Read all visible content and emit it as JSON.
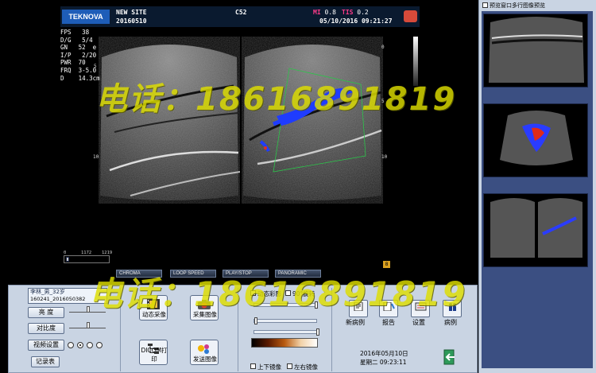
{
  "header": {
    "logo": "TEKNOVA",
    "site": "NEW SITE",
    "date": "20160510",
    "probe": "C52",
    "mi_label": "MI",
    "mi_value": "0.8",
    "tis_label": "TIS",
    "tis_value": "0.2",
    "datetime": "05/10/2016 09:21:27"
  },
  "params": [
    "FPS   38",
    "D/G   5/4",
    "GN   52  e",
    "I/P   2/20",
    "PWR  70",
    "FRQ  3-5.0",
    "D    14.3cm"
  ],
  "depth_marks": [
    "0",
    "5",
    "10"
  ],
  "cine": {
    "start": "0",
    "mid": "1172",
    "end": "1219"
  },
  "watermark": "电话：18616891819",
  "function_tabs": [
    "CHROMA",
    "LOOP SPEED",
    "PLAY/STOP",
    "PANORAMIC"
  ],
  "badge": "8",
  "panel": {
    "patient_name": "李林_男_32岁",
    "patient_id": "160241_2016050382",
    "brightness": "亮  度",
    "contrast": "对比度",
    "video_settings": "视频设置",
    "record": "记录表",
    "dynamic_capture": "动态采像",
    "capture_image": "采集图像",
    "dicom_print": "DICOM打印",
    "send_image": "发送图像",
    "dynamic_color": "动态彩影",
    "rotate_90": "90°旋转",
    "flip_vertical": "上下镜像",
    "flip_horizontal": "左右镜像",
    "new_case": "新病例",
    "report": "报告",
    "settings": "设置",
    "cases": "病例",
    "date_line": "2016年05月10日",
    "time_line": "星期二 09:23:11"
  },
  "sidebar": {
    "header": "预览窗口多行图像预览",
    "thumb_count": 3
  },
  "colors": {
    "panel_bg": "#c9d4e3",
    "sidebar_list_bg": "#3b4f82",
    "doppler_blue": "#1f3cff",
    "watermark": "#dede00"
  }
}
